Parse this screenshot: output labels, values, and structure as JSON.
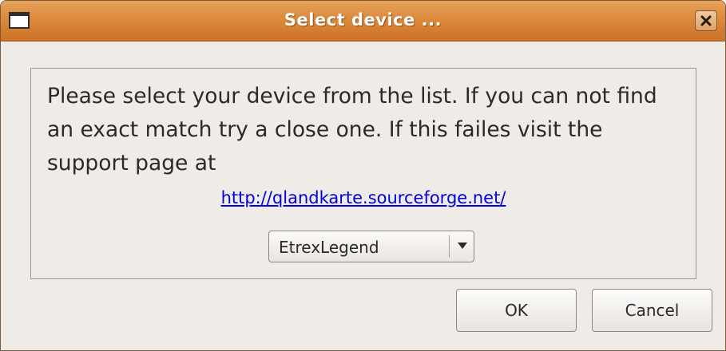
{
  "window": {
    "title": "Select device ...",
    "menu_icon": "window-menu-icon",
    "close_icon": "close-icon"
  },
  "dialog": {
    "message": "Please select your device from the list. If you can not find an exact match try a close one. If this failes visit the support page at",
    "support_link": "http://qlandkarte.sourceforge.net/",
    "device_select": {
      "value": "EtrexLegend",
      "arrow_icon": "chevron-down-icon"
    }
  },
  "buttons": {
    "ok": "OK",
    "cancel": "Cancel"
  },
  "colors": {
    "titlebar": "#dc8a3c",
    "background": "#efebe7",
    "link": "#0000e0"
  }
}
